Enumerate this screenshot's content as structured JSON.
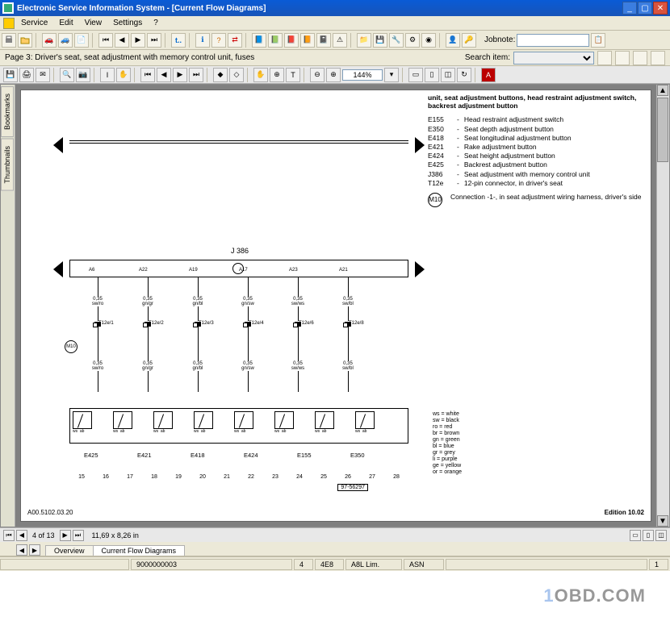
{
  "window": {
    "title": "Electronic Service Information System - [Current Flow Diagrams]"
  },
  "menu": {
    "items": [
      "Service",
      "Edit",
      "View",
      "Settings",
      "?"
    ]
  },
  "toolbar": {
    "jobnote_label": "Jobnote:"
  },
  "inforow": {
    "page_desc": "Page 3: Driver's seat, seat adjustment with memory control unit, fuses",
    "search_label": "Search item:"
  },
  "pdf": {
    "zoom": "144%",
    "nav": {
      "pos": "4 of 13",
      "dims": "11,69 x 8,26 in"
    },
    "side_tabs": [
      "Bookmarks",
      "Thumbnails"
    ]
  },
  "diagram": {
    "section_title": "unit, seat adjustment buttons, head restraint adjustment switch, backrest adjustment button",
    "legend": [
      {
        "k": "E155",
        "v": "Head restraint adjustment switch"
      },
      {
        "k": "E350",
        "v": "Seat depth adjustment button"
      },
      {
        "k": "E418",
        "v": "Seat longitudinal adjustment button"
      },
      {
        "k": "E421",
        "v": "Rake adjustment button"
      },
      {
        "k": "E424",
        "v": "Seat height adjustment button"
      },
      {
        "k": "E425",
        "v": "Backrest adjustment button"
      },
      {
        "k": "J386",
        "v": "Seat adjustment with memory control unit"
      },
      {
        "k": "T12e",
        "v": "12-pin connector, in driver's seat"
      }
    ],
    "m10": {
      "label": "M10",
      "desc": "Connection -1-, in seat adjustment wiring harness, driver's side"
    },
    "bus_label": "J 386",
    "columns": [
      {
        "pin": "A6",
        "g1": "0,35",
        "c1": "sw/ro",
        "conn": "T12e/1",
        "g2": "0,35",
        "c2": "sw/ro"
      },
      {
        "pin": "A22",
        "g1": "0,35",
        "c1": "gn/gr",
        "conn": "T12e/2",
        "g2": "0,35",
        "c2": "gn/gr"
      },
      {
        "pin": "A19",
        "g1": "0,35",
        "c1": "gn/bl",
        "conn": "T12e/3",
        "g2": "0,35",
        "c2": "gn/bl"
      },
      {
        "pin": "A17",
        "g1": "0,35",
        "c1": "gn/sw",
        "conn": "T12e/4",
        "g2": "0,35",
        "c2": "gn/sw"
      },
      {
        "pin": "A23",
        "g1": "0,35",
        "c1": "sw/ws",
        "conn": "T12e/6",
        "g2": "0,35",
        "c2": "sw/ws"
      },
      {
        "pin": "A21",
        "g1": "0,35",
        "c1": "sw/bl",
        "conn": "T12e/8",
        "g2": "0,35",
        "c2": "sw/bl"
      }
    ],
    "bottom_labels": [
      "E425",
      "E421",
      "E418",
      "E424",
      "E155",
      "E350"
    ],
    "numbers": [
      "15",
      "16",
      "17",
      "18",
      "19",
      "20",
      "21",
      "22",
      "23",
      "24",
      "25",
      "26",
      "27",
      "28"
    ],
    "boxnum": "97-56297",
    "footer_left": "A00.5102.03.20",
    "footer_right": "Edition 10.02",
    "color_legend": [
      "ws  = white",
      "sw  = black",
      "ro  = red",
      "br  = brown",
      "gn  = green",
      "bl  = blue",
      "gr  = grey",
      "li  = purple",
      "ge  = yellow",
      "or  = orange"
    ],
    "m10_circle": "M10"
  },
  "bottom_tabs": {
    "items": [
      "Overview",
      "Current Flow Diagrams"
    ],
    "active": 1
  },
  "status": {
    "cells": [
      "",
      "9000000003",
      "4",
      "4E8",
      "A8L Lim.",
      "ASN",
      "",
      "1"
    ]
  },
  "watermark": {
    "a": "1",
    "b": "OBD.COM"
  }
}
